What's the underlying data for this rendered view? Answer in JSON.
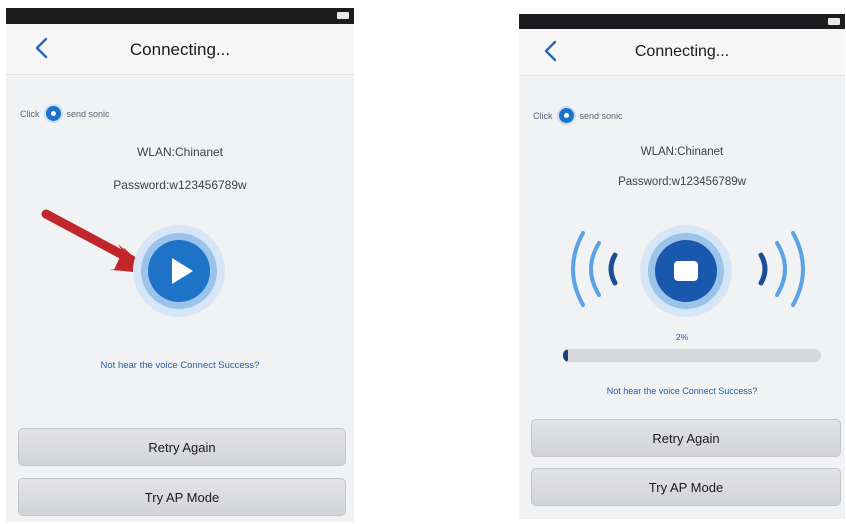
{
  "screens": [
    {
      "title": "Connecting...",
      "click_label": "Click",
      "send_label": "send sonic",
      "wlan": "WLAN:Chinanet",
      "password": "Password:w123456789w",
      "hint": "Not hear the voice Connect Success?",
      "retry_button": "Retry Again",
      "ap_button": "Try AP Mode",
      "play_state": "play",
      "has_arrow": true
    },
    {
      "title": "Connecting...",
      "click_label": "Click",
      "send_label": "send sonic",
      "wlan": "WLAN:Chinanet",
      "password": "Password:w123456789w",
      "progress_label": "2%",
      "progress_value": 0.02,
      "hint": "Not hear the voice Connect Success?",
      "retry_button": "Retry Again",
      "ap_button": "Try AP Mode",
      "play_state": "stop",
      "has_sound_waves": true
    }
  ],
  "colors": {
    "accent_blue": "#1e73c9",
    "arrow_red": "#c0262c",
    "hint_blue": "#1f5fa8"
  },
  "icons": {
    "back": "chevron-left-icon",
    "play": "play-icon",
    "stop": "stop-icon",
    "sound_waves": "sound-waves-icon",
    "arrow": "red-arrow-icon"
  }
}
